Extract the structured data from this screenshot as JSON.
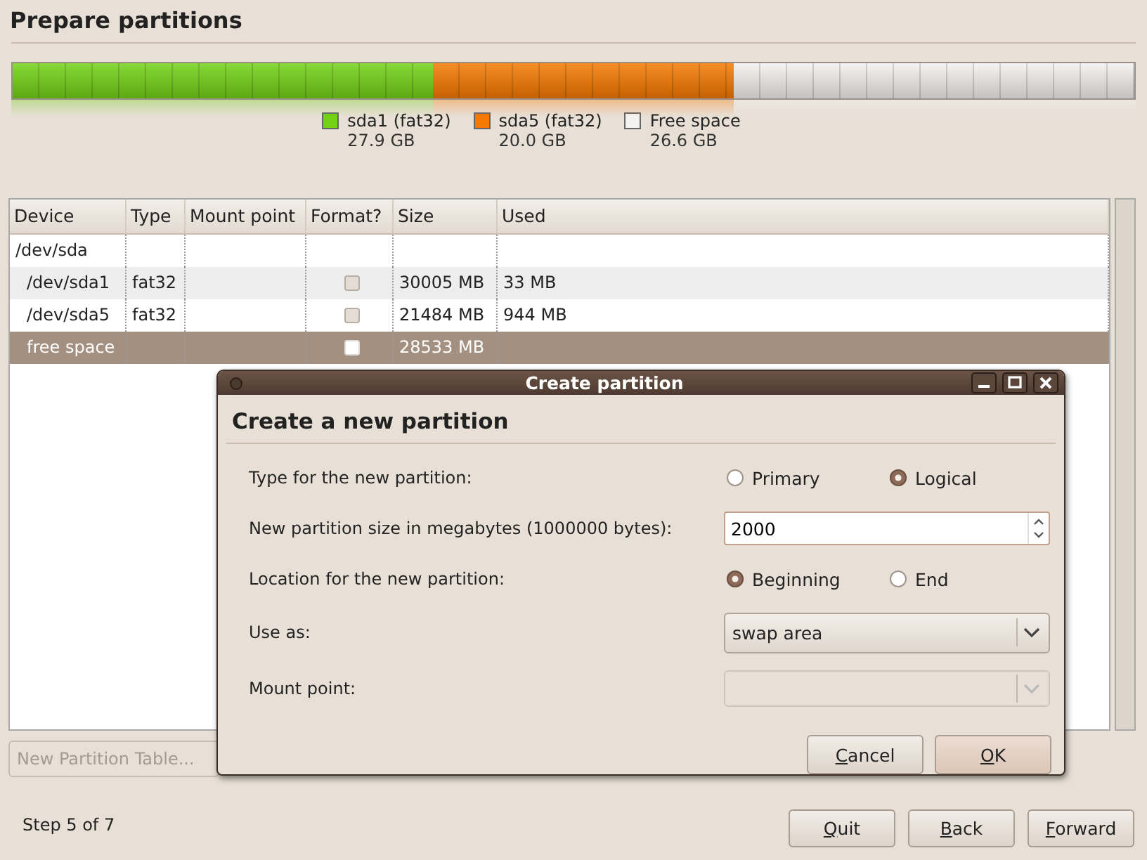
{
  "title": "Prepare partitions",
  "legend": [
    {
      "name": "sda1 (fat32)",
      "size": "27.9 GB",
      "color": "#73d216"
    },
    {
      "name": "sda5 (fat32)",
      "size": "20.0 GB",
      "color": "#f57900"
    },
    {
      "name": "Free space",
      "size": "26.6 GB",
      "color": "#f4f2f0"
    }
  ],
  "table": {
    "columns": [
      "Device",
      "Type",
      "Mount point",
      "Format?",
      "Size",
      "Used"
    ],
    "rows": [
      {
        "device": "/dev/sda",
        "selected": false,
        "children": [
          {
            "device": "/dev/sda1",
            "type": "fat32",
            "format": {
              "checked": false,
              "disabled": true
            },
            "size": "30005 MB",
            "used": "33 MB",
            "selected": false
          },
          {
            "device": "/dev/sda5",
            "type": "fat32",
            "format": {
              "checked": false,
              "disabled": true
            },
            "size": "21484 MB",
            "used": "944 MB",
            "selected": false
          },
          {
            "device": "free space",
            "format": {
              "checked": false,
              "disabled": false
            },
            "size": "28533 MB",
            "selected": true
          }
        ]
      }
    ]
  },
  "new_table_button": {
    "label": "New Partition Table...",
    "disabled": true
  },
  "dialog": {
    "title": "Create partition",
    "heading": "Create a new partition",
    "rows": [
      {
        "kind": "radio",
        "label": "Type for the new partition:",
        "options": [
          {
            "label": "Primary",
            "selected": false
          },
          {
            "label": "Logical",
            "selected": true
          }
        ]
      },
      {
        "kind": "spin",
        "label": "New partition size in megabytes (1000000 bytes):",
        "value": "2000"
      },
      {
        "kind": "radio",
        "label": "Location for the new partition:",
        "options": [
          {
            "label": "Beginning",
            "selected": true
          },
          {
            "label": "End",
            "selected": false
          }
        ]
      },
      {
        "kind": "combo",
        "label": "Use as:",
        "value": "swap area",
        "disabled": false
      },
      {
        "kind": "combo",
        "label": "Mount point:",
        "disabled": true
      }
    ],
    "buttons": [
      {
        "key": "C",
        "rest": "ancel",
        "default": false
      },
      {
        "key": "O",
        "rest": "K",
        "default": true
      }
    ]
  },
  "step": "Step 5 of 7",
  "buttons": [
    {
      "key": "Q",
      "rest": "uit"
    },
    {
      "key": "B",
      "rest": "ack"
    },
    {
      "key": "F",
      "rest": "orward"
    }
  ]
}
